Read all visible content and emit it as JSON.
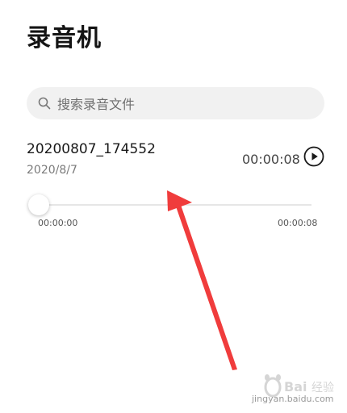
{
  "header": {
    "title": "录音机"
  },
  "search": {
    "placeholder": "搜索录音文件",
    "icon": "search-icon"
  },
  "recording": {
    "name": "20200807_174552",
    "date": "2020/8/7",
    "duration": "00:00:08",
    "play_icon": "play-icon"
  },
  "player": {
    "current_time": "00:00:00",
    "total_time": "00:00:08",
    "progress": 0
  },
  "annotation": {
    "type": "red-arrow",
    "color": "#f03c3c"
  },
  "watermark": {
    "brand": "Baidu经验",
    "url": "jingyan.baidu.com"
  },
  "colors": {
    "background": "#ffffff",
    "search_bg": "#f1f1f1",
    "arrow": "#f03c3c"
  }
}
